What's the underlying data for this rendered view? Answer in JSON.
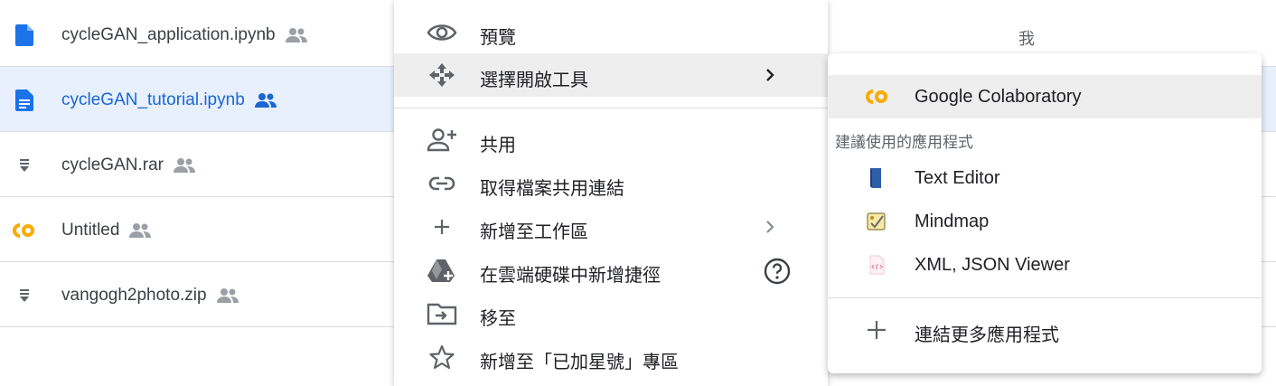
{
  "files": [
    {
      "name": "cycleGAN_application.ipynb",
      "icon": "document-icon",
      "selected": false
    },
    {
      "name": "cycleGAN_tutorial.ipynb",
      "icon": "document-icon",
      "selected": true
    },
    {
      "name": "cycleGAN.rar",
      "icon": "archive-icon",
      "selected": false
    },
    {
      "name": "Untitled",
      "icon": "colab-icon",
      "selected": false
    },
    {
      "name": "vangogh2photo.zip",
      "icon": "archive-icon",
      "selected": false
    }
  ],
  "owner_label": "我",
  "context_menu": {
    "items": [
      {
        "label": "預覽",
        "icon": "eye-icon"
      },
      {
        "label": "選擇開啟工具",
        "icon": "move-arrows-icon",
        "submenu": true
      },
      {
        "label": "共用",
        "icon": "add-person-icon"
      },
      {
        "label": "取得檔案共用連結",
        "icon": "link-icon"
      },
      {
        "label": "新增至工作區",
        "icon": "plus-icon",
        "submenu": true
      },
      {
        "label": "在雲端硬碟中新增捷徑",
        "icon": "drive-shortcut-icon",
        "help": true
      },
      {
        "label": "移至",
        "icon": "move-to-folder-icon"
      },
      {
        "label": "新增至「已加星號」專區",
        "icon": "star-icon"
      }
    ]
  },
  "open_with_submenu": {
    "top_app": {
      "label": "Google Colaboratory",
      "icon": "colab-icon"
    },
    "section_label": "建議使用的應用程式",
    "suggested": [
      {
        "label": "Text Editor",
        "icon": "text-editor-icon"
      },
      {
        "label": "Mindmap",
        "icon": "mindmap-icon"
      },
      {
        "label": "XML, JSON Viewer",
        "icon": "xml-viewer-icon"
      }
    ],
    "connect_more": {
      "label": "連結更多應用程式",
      "icon": "plus-icon"
    }
  },
  "colors": {
    "drive_blue": "#1a73e8",
    "selected_row_bg": "#e8f0fe",
    "selected_text": "#1967d2",
    "colab_orange": "#f9ab00",
    "hover_bg": "#eeeeee"
  }
}
